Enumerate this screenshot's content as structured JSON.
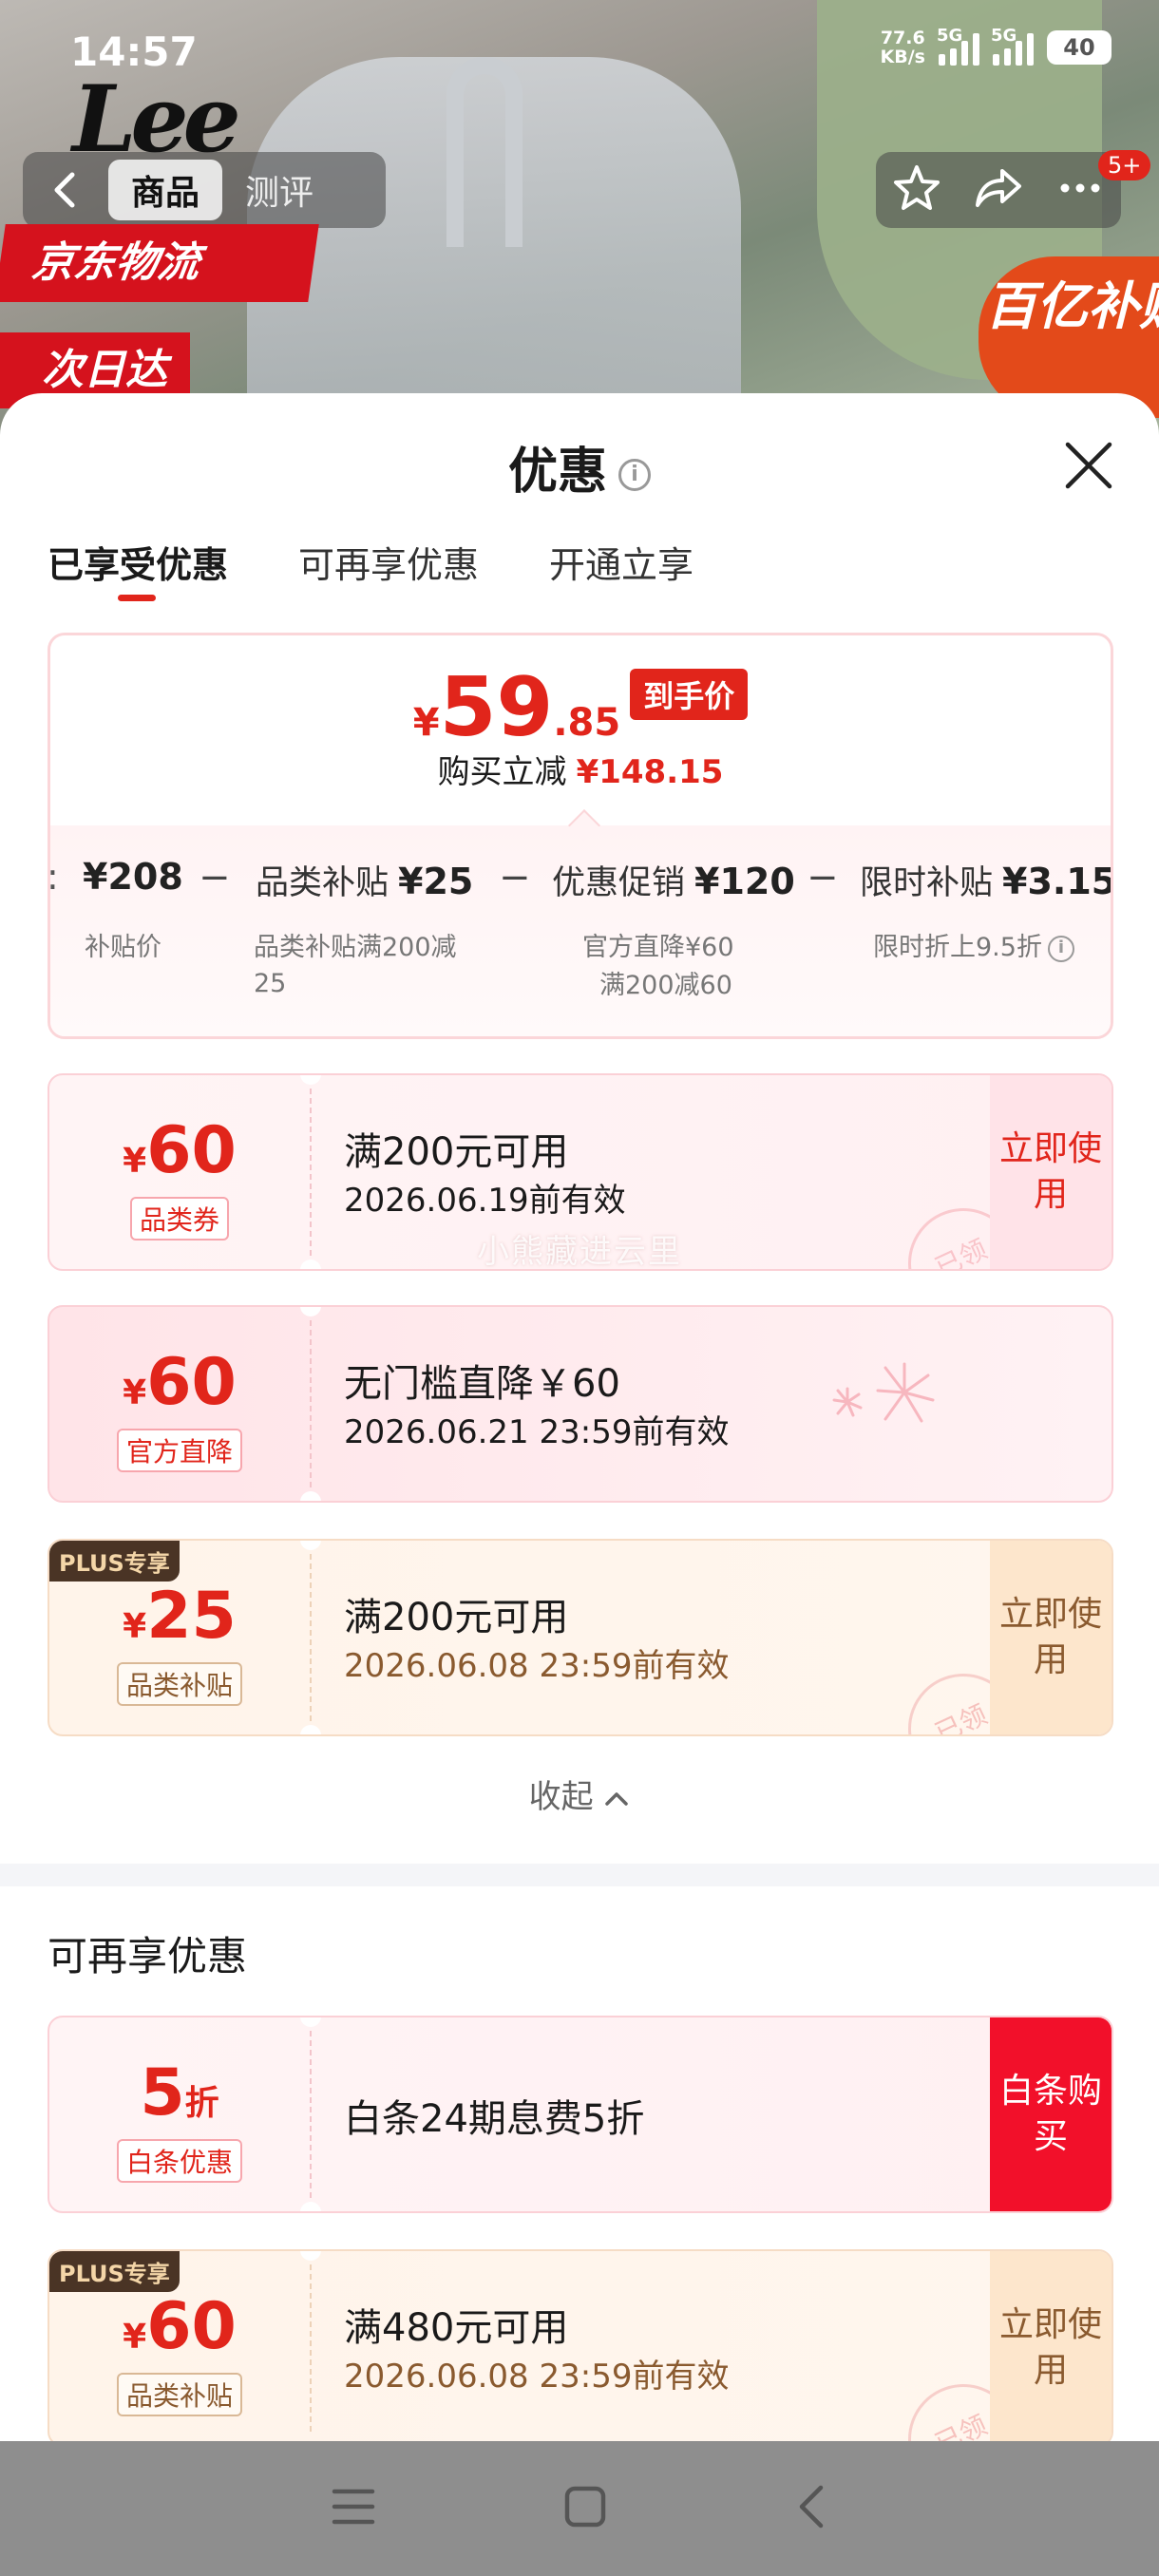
{
  "status": {
    "time": "14:57",
    "net_speed_top": "77.6",
    "net_speed_bottom": "KB/s",
    "sig1_label": "5G",
    "sig2_label": "5G",
    "battery": "40"
  },
  "product_header": {
    "brand_logo": "Lee",
    "tabs": [
      "商品",
      "测评"
    ],
    "badge": "5+",
    "banner_logistics": "京东物流",
    "banner_nextday": "次日达",
    "banner_subsidy": "百亿补贴"
  },
  "sheet": {
    "title": "优惠",
    "tabs": [
      "已享受优惠",
      "可再享优惠",
      "开通立享"
    ],
    "summary": {
      "currency": "¥",
      "price_int": "59",
      "price_dec": ".85",
      "price_tag": "到手价",
      "reduce_label": "购买立减",
      "reduce_amount": "¥148.15",
      "calc": [
        {
          "label": "",
          "value": "¥208",
          "sub": "补贴价"
        },
        {
          "label": "品类补贴",
          "value": "¥25",
          "sub": "品类补贴满200减25"
        },
        {
          "label": "优惠促销",
          "value": "¥120",
          "sub1": "官方直降¥60",
          "sub2": "满200减60"
        },
        {
          "label": "限时补贴",
          "value": "¥3.15",
          "sub": "限时折上9.5折"
        }
      ],
      "op_minus": "−",
      "leading_mark": ":"
    },
    "coupons": [
      {
        "currency": "¥",
        "amount": "60",
        "unit": "",
        "tag": "品类券",
        "title": "满200元可用",
        "sub": "2026.06.19前有效",
        "action": "立即使用",
        "stamp": "已领",
        "plus": ""
      },
      {
        "currency": "¥",
        "amount": "60",
        "unit": "",
        "tag": "官方直降",
        "title": "无门槛直降￥60",
        "sub": "2026.06.21 23:59前有效",
        "action": "",
        "stamp": "",
        "plus": ""
      },
      {
        "currency": "¥",
        "amount": "25",
        "unit": "",
        "tag": "品类补贴",
        "title": "满200元可用",
        "sub": "2026.06.08 23:59前有效",
        "action": "立即使用",
        "stamp": "已领",
        "plus": "PLUS专享"
      }
    ],
    "watermark": "小熊藏进云里",
    "collapse": "收起",
    "section2_title": "可再享优惠",
    "coupons2": [
      {
        "currency": "",
        "amount": "5",
        "unit": "折",
        "tag": "白条优惠",
        "title": "白条24期息费5折",
        "action": "白条购买"
      },
      {
        "currency": "¥",
        "amount": "60",
        "unit": "",
        "tag": "品类补贴",
        "title": "满480元可用",
        "sub": "2026.06.08 23:59前有效",
        "action": "立即使用",
        "stamp": "已领",
        "plus": "PLUS专享"
      }
    ]
  },
  "colors": {
    "accent": "#e1251b",
    "gold_text": "#8a5a2f"
  }
}
